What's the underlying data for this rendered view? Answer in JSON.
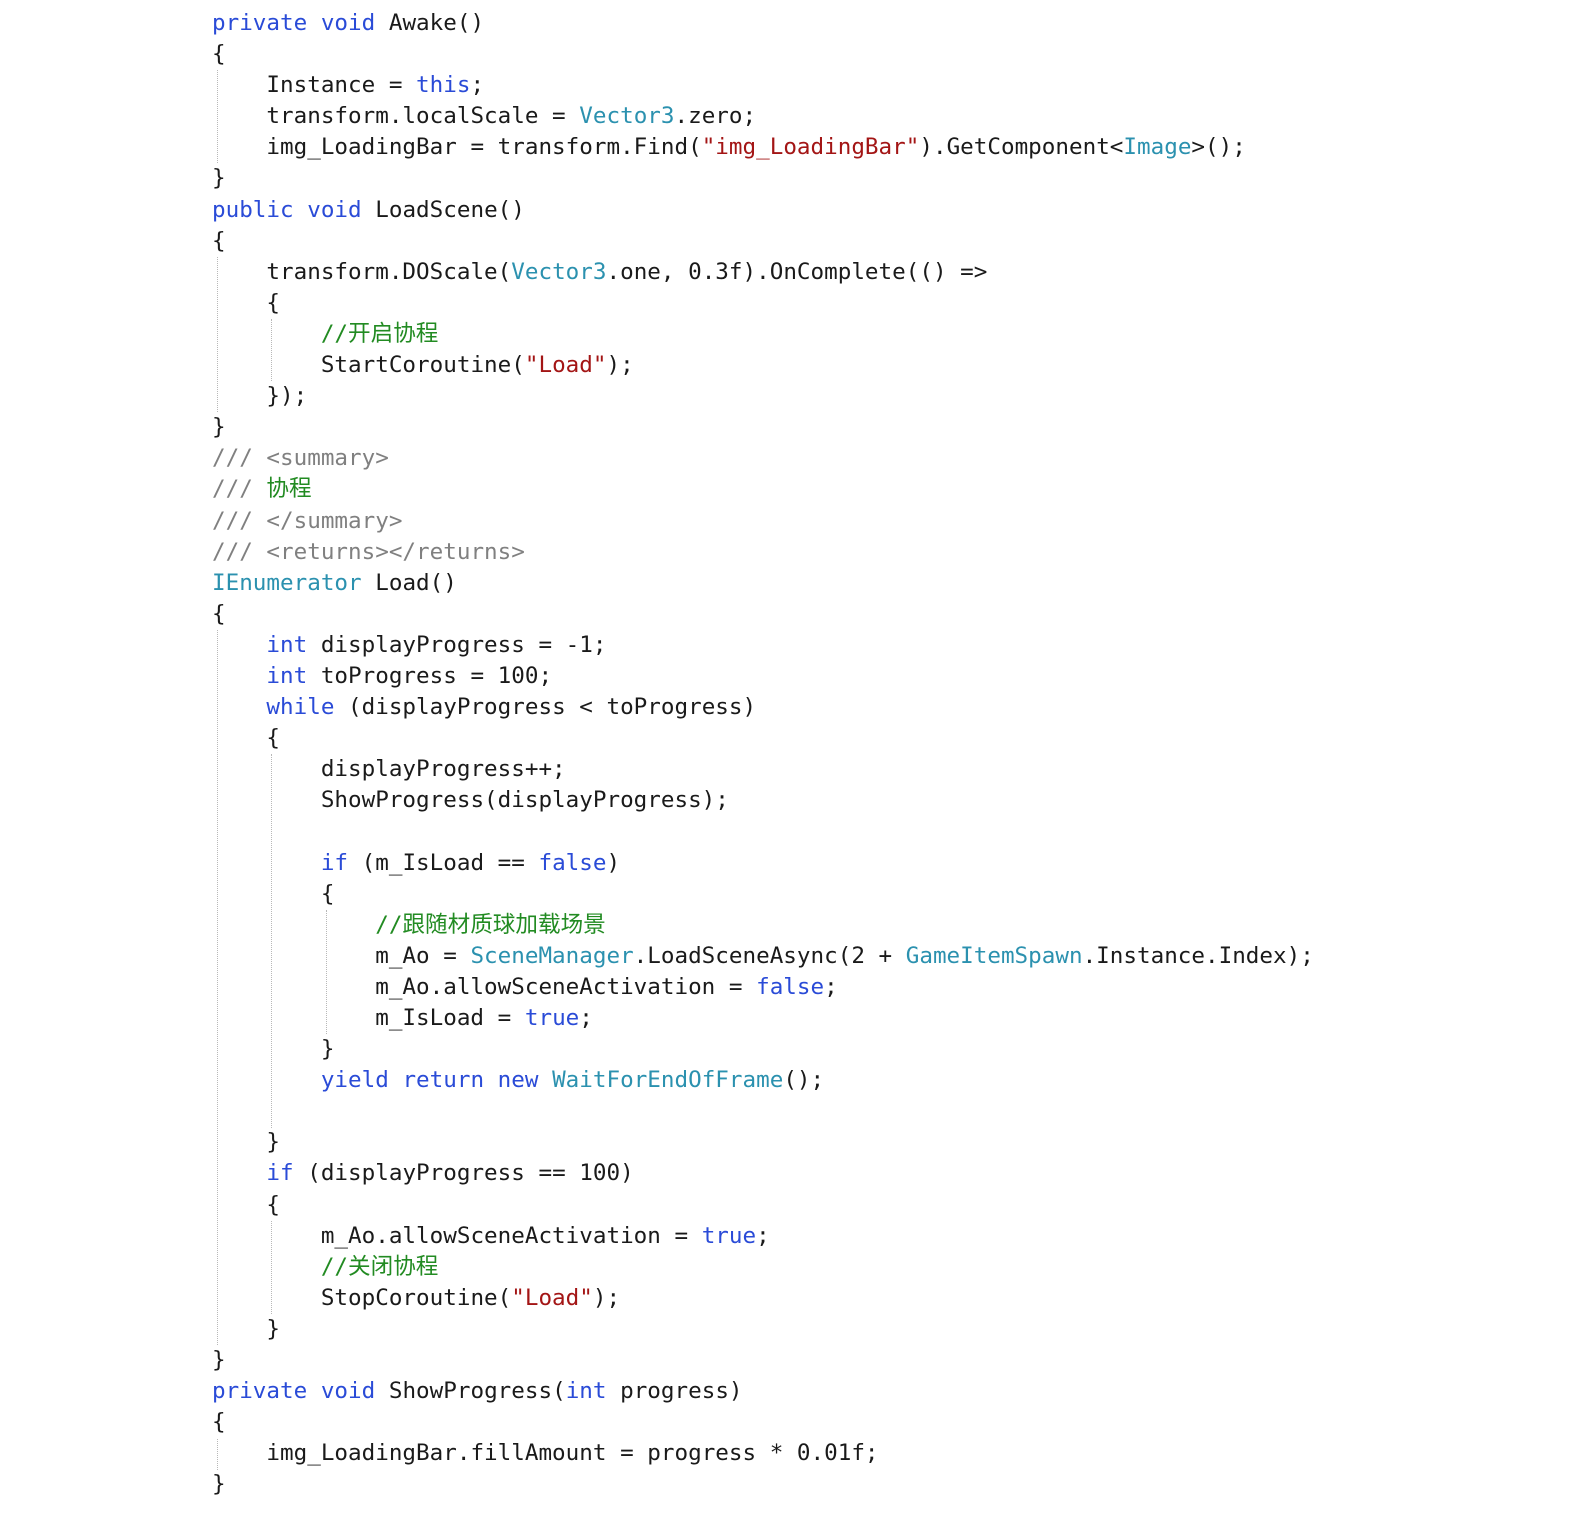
{
  "colors": {
    "background": "#ffffff",
    "plain": "#1a1a1a",
    "keyword": "#2a4bd7",
    "type": "#2b91af",
    "string": "#a31515",
    "comment": "#228b22",
    "doc": "#808080",
    "indent_guide": "#b8b8b8"
  },
  "code": {
    "lines": [
      {
        "indent": 0,
        "tokens": [
          {
            "keyword": "private "
          },
          {
            "keyword": "void"
          },
          {
            "plain": " Awake()"
          }
        ]
      },
      {
        "indent": 0,
        "tokens": [
          {
            "plain": "{"
          }
        ]
      },
      {
        "indent": 1,
        "tokens": [
          {
            "plain": "Instance = "
          },
          {
            "keyword": "this"
          },
          {
            "plain": ";"
          }
        ]
      },
      {
        "indent": 1,
        "tokens": [
          {
            "plain": "transform.localScale = "
          },
          {
            "type": "Vector3"
          },
          {
            "plain": ".zero;"
          }
        ]
      },
      {
        "indent": 1,
        "tokens": [
          {
            "plain": "img_LoadingBar = transform.Find("
          },
          {
            "string": "\"img_LoadingBar\""
          },
          {
            "plain": ").GetComponent<"
          },
          {
            "type": "Image"
          },
          {
            "plain": ">();"
          }
        ]
      },
      {
        "indent": 0,
        "tokens": [
          {
            "plain": "}"
          }
        ]
      },
      {
        "indent": 0,
        "tokens": [
          {
            "keyword": "public "
          },
          {
            "keyword": "void"
          },
          {
            "plain": " LoadScene()"
          }
        ]
      },
      {
        "indent": 0,
        "tokens": [
          {
            "plain": "{"
          }
        ]
      },
      {
        "indent": 1,
        "tokens": [
          {
            "plain": "transform.DOScale("
          },
          {
            "type": "Vector3"
          },
          {
            "plain": ".one, 0.3f).OnComplete(() =>"
          }
        ]
      },
      {
        "indent": 1,
        "tokens": [
          {
            "plain": "{"
          }
        ]
      },
      {
        "indent": 2,
        "tokens": [
          {
            "comment": "//开启协程"
          }
        ]
      },
      {
        "indent": 2,
        "tokens": [
          {
            "plain": "StartCoroutine("
          },
          {
            "string": "\"Load\""
          },
          {
            "plain": ");"
          }
        ]
      },
      {
        "indent": 1,
        "tokens": [
          {
            "plain": "});"
          }
        ]
      },
      {
        "indent": 0,
        "tokens": [
          {
            "plain": "}"
          }
        ]
      },
      {
        "indent": 0,
        "tokens": [
          {
            "doc": "/// <summary>"
          }
        ]
      },
      {
        "indent": 0,
        "tokens": [
          {
            "doc": "/// "
          },
          {
            "comment": "协程"
          }
        ]
      },
      {
        "indent": 0,
        "tokens": [
          {
            "doc": "/// </summary>"
          }
        ]
      },
      {
        "indent": 0,
        "tokens": [
          {
            "doc": "/// <returns></returns>"
          }
        ]
      },
      {
        "indent": 0,
        "tokens": [
          {
            "type": "IEnumerator"
          },
          {
            "plain": " Load()"
          }
        ]
      },
      {
        "indent": 0,
        "tokens": [
          {
            "plain": "{"
          }
        ]
      },
      {
        "indent": 1,
        "tokens": [
          {
            "keyword": "int"
          },
          {
            "plain": " displayProgress = -1;"
          }
        ]
      },
      {
        "indent": 1,
        "tokens": [
          {
            "keyword": "int"
          },
          {
            "plain": " toProgress = 100;"
          }
        ]
      },
      {
        "indent": 1,
        "tokens": [
          {
            "keyword": "while"
          },
          {
            "plain": " (displayProgress < toProgress)"
          }
        ]
      },
      {
        "indent": 1,
        "tokens": [
          {
            "plain": "{"
          }
        ]
      },
      {
        "indent": 2,
        "tokens": [
          {
            "plain": "displayProgress++;"
          }
        ]
      },
      {
        "indent": 2,
        "tokens": [
          {
            "plain": "ShowProgress(displayProgress);"
          }
        ]
      },
      {
        "indent": 0,
        "tokens": []
      },
      {
        "indent": 2,
        "tokens": [
          {
            "keyword": "if"
          },
          {
            "plain": " (m_IsLoad == "
          },
          {
            "keyword": "false"
          },
          {
            "plain": ")"
          }
        ]
      },
      {
        "indent": 2,
        "tokens": [
          {
            "plain": "{"
          }
        ]
      },
      {
        "indent": 3,
        "tokens": [
          {
            "comment": "//跟随材质球加载场景"
          }
        ]
      },
      {
        "indent": 3,
        "tokens": [
          {
            "plain": "m_Ao = "
          },
          {
            "type": "SceneManager"
          },
          {
            "plain": ".LoadSceneAsync(2 + "
          },
          {
            "type": "GameItemSpawn"
          },
          {
            "plain": ".Instance.Index);"
          }
        ]
      },
      {
        "indent": 3,
        "tokens": [
          {
            "plain": "m_Ao.allowSceneActivation = "
          },
          {
            "keyword": "false"
          },
          {
            "plain": ";"
          }
        ]
      },
      {
        "indent": 3,
        "tokens": [
          {
            "plain": "m_IsLoad = "
          },
          {
            "keyword": "true"
          },
          {
            "plain": ";"
          }
        ]
      },
      {
        "indent": 2,
        "tokens": [
          {
            "plain": "}"
          }
        ]
      },
      {
        "indent": 2,
        "tokens": [
          {
            "keyword": "yield "
          },
          {
            "keyword": "return "
          },
          {
            "keyword": "new "
          },
          {
            "type": "WaitForEndOfFrame"
          },
          {
            "plain": "();"
          }
        ]
      },
      {
        "indent": 0,
        "tokens": []
      },
      {
        "indent": 1,
        "tokens": [
          {
            "plain": "}"
          }
        ]
      },
      {
        "indent": 1,
        "tokens": [
          {
            "keyword": "if"
          },
          {
            "plain": " (displayProgress == 100)"
          }
        ]
      },
      {
        "indent": 1,
        "tokens": [
          {
            "plain": "{"
          }
        ]
      },
      {
        "indent": 2,
        "tokens": [
          {
            "plain": "m_Ao.allowSceneActivation = "
          },
          {
            "keyword": "true"
          },
          {
            "plain": ";"
          }
        ]
      },
      {
        "indent": 2,
        "tokens": [
          {
            "comment": "//关闭协程"
          }
        ]
      },
      {
        "indent": 2,
        "tokens": [
          {
            "plain": "StopCoroutine("
          },
          {
            "string": "\"Load\""
          },
          {
            "plain": ");"
          }
        ]
      },
      {
        "indent": 1,
        "tokens": [
          {
            "plain": "}"
          }
        ]
      },
      {
        "indent": 0,
        "tokens": [
          {
            "plain": "}"
          }
        ]
      },
      {
        "indent": 0,
        "tokens": [
          {
            "keyword": "private "
          },
          {
            "keyword": "void"
          },
          {
            "plain": " ShowProgress("
          },
          {
            "keyword": "int"
          },
          {
            "plain": " progress)"
          }
        ]
      },
      {
        "indent": 0,
        "tokens": [
          {
            "plain": "{"
          }
        ]
      },
      {
        "indent": 1,
        "tokens": [
          {
            "plain": "img_LoadingBar.fillAmount = progress * 0.01f;"
          }
        ]
      },
      {
        "indent": 0,
        "tokens": [
          {
            "plain": "}"
          }
        ]
      }
    ]
  }
}
